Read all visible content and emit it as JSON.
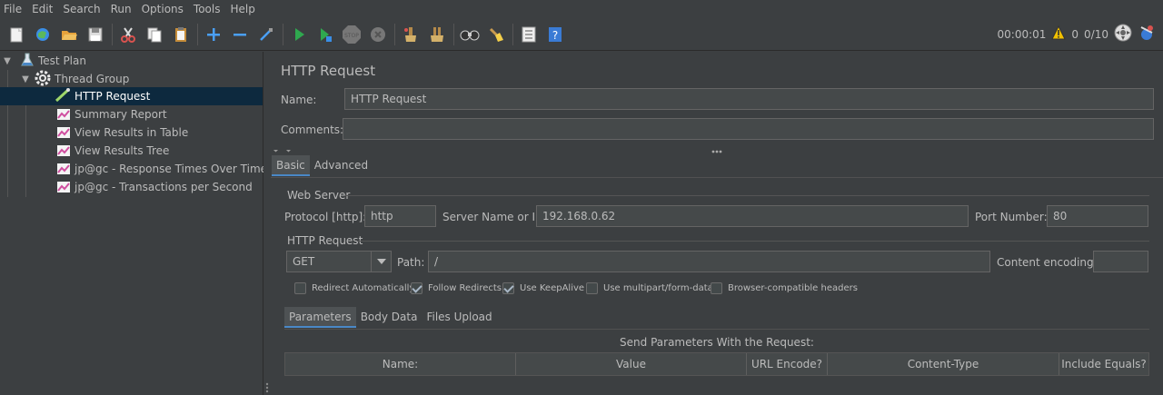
{
  "menu": [
    "File",
    "Edit",
    "Search",
    "Run",
    "Options",
    "Tools",
    "Help"
  ],
  "toolbar": {
    "buttons": [
      "new-icon",
      "templates-icon",
      "open-icon",
      "save-icon",
      "cut-icon",
      "copy-icon",
      "paste-icon",
      "expand-icon",
      "collapse-icon",
      "toggle-icon",
      "start-icon",
      "start-no-pause-icon",
      "stop-icon",
      "shutdown-icon",
      "clear-icon",
      "clear-all-icon",
      "search-icon",
      "reset-search-icon",
      "function-helper-icon",
      "help-icon"
    ],
    "timer": "00:00:01",
    "warnings": "0",
    "threads": "0/10"
  },
  "tree": {
    "items": [
      {
        "label": "Test Plan",
        "icon": "flask-icon"
      },
      {
        "label": "Thread Group",
        "icon": "gear-icon"
      },
      {
        "label": "HTTP Request",
        "icon": "pipette-icon"
      },
      {
        "label": "Summary Report",
        "icon": "chart-icon"
      },
      {
        "label": "View Results in Table",
        "icon": "chart-icon"
      },
      {
        "label": "View Results Tree",
        "icon": "chart-icon"
      },
      {
        "label": "jp@gc - Response Times Over Time",
        "icon": "chart-icon"
      },
      {
        "label": "jp@gc - Transactions per Second",
        "icon": "chart-icon"
      }
    ]
  },
  "editor": {
    "title": "HTTP Request",
    "name_label": "Name:",
    "name_value": "HTTP Request",
    "comments_label": "Comments:",
    "comments_value": "",
    "tabs": [
      "Basic",
      "Advanced"
    ],
    "web_server": {
      "title": "Web Server",
      "protocol_label": "Protocol [http]:",
      "protocol_value": "http",
      "server_label": "Server Name or IP:",
      "server_value": "192.168.0.62",
      "port_label": "Port Number:",
      "port_value": "80"
    },
    "http_request": {
      "title": "HTTP Request",
      "method": "GET",
      "path_label": "Path:",
      "path_value": "/",
      "encoding_label": "Content encoding:",
      "encoding_value": ""
    },
    "options": [
      {
        "label": "Redirect Automatically",
        "checked": false
      },
      {
        "label": "Follow Redirects",
        "checked": true
      },
      {
        "label": "Use KeepAlive",
        "checked": true
      },
      {
        "label": "Use multipart/form-data",
        "checked": false
      },
      {
        "label": "Browser-compatible headers",
        "checked": false
      }
    ],
    "sub_tabs": [
      "Parameters",
      "Body Data",
      "Files Upload"
    ],
    "table_title": "Send Parameters With the Request:",
    "columns": [
      "Name:",
      "Value",
      "URL Encode?",
      "Content-Type",
      "Include Equals?"
    ]
  }
}
